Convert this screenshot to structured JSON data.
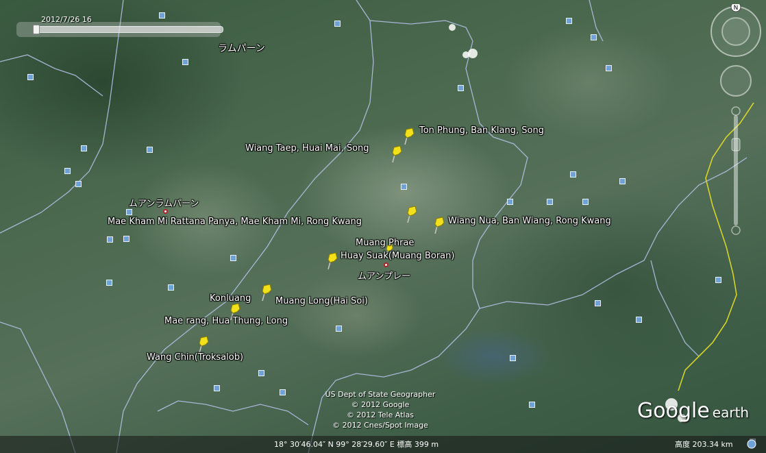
{
  "time_slider": {
    "date_label": "2012/7/26  16"
  },
  "region_labels": [
    {
      "id": "lampang-region",
      "text": "ラムパーン"
    },
    {
      "id": "muang-lampang",
      "text": "ムアンラムパーン"
    },
    {
      "id": "muang-phrae-jp",
      "text": "ムアンプレー"
    }
  ],
  "placemarks": [
    {
      "id": "ton-phung",
      "label": "Ton Phung, Ban Klang, Song"
    },
    {
      "id": "wiang-taep",
      "label": "Wiang Taep, Huai Mai, Song"
    },
    {
      "id": "mae-kham-mi",
      "label": "Mae Kham Mi Rattana Panya, Mae Kham Mi, Rong Kwang"
    },
    {
      "id": "wiang-nua",
      "label": "Wiang Nua, Ban Wiang, Rong Kwang"
    },
    {
      "id": "muang-phrae",
      "label": "Muang Phrae"
    },
    {
      "id": "huay-suak",
      "label": "Huay Suak(Muang Boran)"
    },
    {
      "id": "konluang",
      "label": "Konluang"
    },
    {
      "id": "muang-long",
      "label": "Muang Long(Hai Soi)"
    },
    {
      "id": "mae-rang",
      "label": "Mae rang, Hua Thung, Long"
    },
    {
      "id": "wang-chin",
      "label": "Wang Chin(Troksalob)"
    }
  ],
  "credits": [
    "US Dept of State Geographer",
    "© 2012 Google",
    "© 2012 Tele Atlas",
    "© 2012 Cnes/Spot Image"
  ],
  "brand": {
    "google": "Google",
    "earth": "earth"
  },
  "status": {
    "coordinates": "18° 30′46.04″ N  99° 28′29.60″ E  標高  399 m",
    "eye_altitude": "高度    203.34 km"
  },
  "navigation": {
    "north_label": "N"
  },
  "colors": {
    "boundary": "#b9c6ee",
    "border_yellow": "#d6d42a",
    "pin": "#f2e01a",
    "city_marker": "#b5202a"
  }
}
